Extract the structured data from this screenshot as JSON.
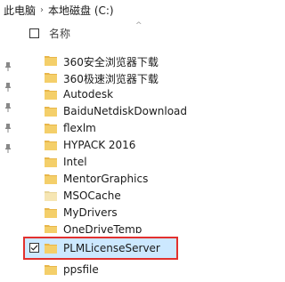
{
  "breadcrumb": {
    "items": [
      "此电脑",
      "本地磁盘 (C:)"
    ]
  },
  "header": {
    "name_label": "名称",
    "sort_glyph": "^"
  },
  "folders": [
    {
      "name": "360安全浏览器下载",
      "pinned": true
    },
    {
      "name": "360极速浏览器下载",
      "pinned": true
    },
    {
      "name": "Autodesk",
      "pinned": true
    },
    {
      "name": "BaiduNetdiskDownload",
      "pinned": true
    },
    {
      "name": "flexlm",
      "pinned": true
    },
    {
      "name": "HYPACK 2016",
      "pinned": false
    },
    {
      "name": "Intel",
      "pinned": false
    },
    {
      "name": "MentorGraphics",
      "pinned": false
    },
    {
      "name": "MSOCache",
      "pinned": false
    },
    {
      "name": "MyDrivers",
      "pinned": false
    },
    {
      "name": "OneDriveTemp",
      "pinned": false
    },
    {
      "name": "PLMLicenseServer",
      "pinned": false,
      "selected": true
    },
    {
      "name": "ppsfile",
      "pinned": false
    }
  ],
  "colors": {
    "folder": "#e8b64a",
    "selection_bg": "#cce8ff",
    "highlight_border": "#e2312e"
  },
  "icons": {
    "folder": "folder-icon",
    "pin": "pin-icon",
    "checkbox": "checkbox-icon"
  }
}
